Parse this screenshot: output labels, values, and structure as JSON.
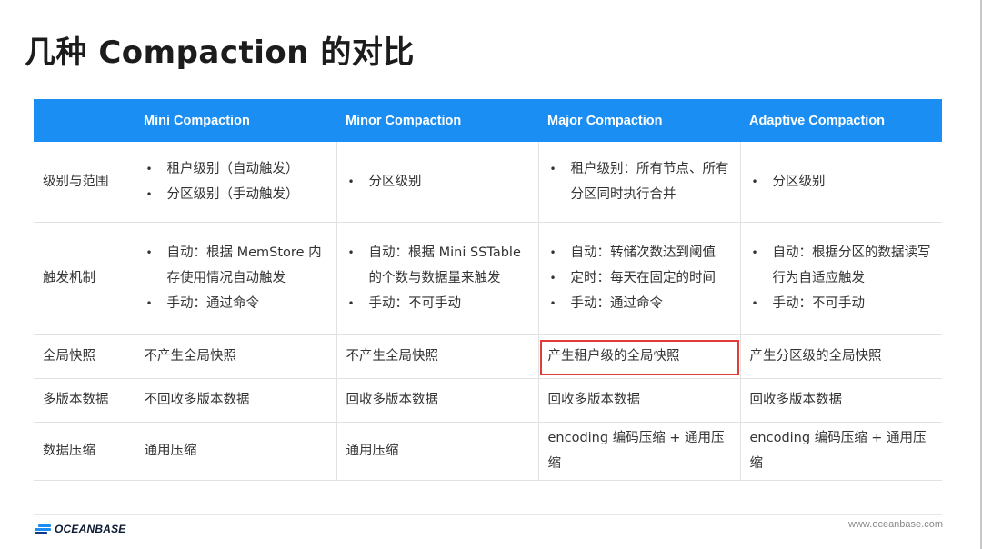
{
  "title": "几种 Compaction 的对比",
  "table": {
    "columns": [
      "",
      "Mini Compaction",
      "Minor Compaction",
      "Major Compaction",
      "Adaptive Compaction"
    ],
    "rows": [
      {
        "label": "级别与范围",
        "cells": [
          {
            "bullets": [
              "租户级别（自动触发）",
              "分区级别（手动触发）"
            ]
          },
          {
            "bullets": [
              "分区级别"
            ]
          },
          {
            "bullets": [
              "租户级别：所有节点、所有分区同时执行合并"
            ]
          },
          {
            "bullets": [
              "分区级别"
            ]
          }
        ]
      },
      {
        "label": "触发机制",
        "cells": [
          {
            "bullets": [
              "自动：根据 MemStore 内存使用情况自动触发",
              "手动：通过命令"
            ]
          },
          {
            "bullets": [
              "自动：根据 Mini SSTable 的个数与数据量来触发",
              "手动：不可手动"
            ]
          },
          {
            "bullets": [
              "自动：转储次数达到阈值",
              "定时：每天在固定的时间",
              "手动：通过命令"
            ]
          },
          {
            "bullets": [
              "自动：根据分区的数据读写行为自适应触发",
              "手动：不可手动"
            ]
          }
        ]
      },
      {
        "label": "全局快照",
        "cells": [
          {
            "text": "不产生全局快照"
          },
          {
            "text": "不产生全局快照"
          },
          {
            "text": "产生租户级的全局快照",
            "highlight": true
          },
          {
            "text": "产生分区级的全局快照"
          }
        ]
      },
      {
        "label": "多版本数据",
        "cells": [
          {
            "text": "不回收多版本数据"
          },
          {
            "text": "回收多版本数据"
          },
          {
            "text": "回收多版本数据"
          },
          {
            "text": "回收多版本数据"
          }
        ]
      },
      {
        "label": "数据压缩",
        "cells": [
          {
            "text": "通用压缩"
          },
          {
            "text": "通用压缩"
          },
          {
            "text": "encoding 编码压缩 + 通用压缩"
          },
          {
            "text": "encoding 编码压缩 + 通用压缩"
          }
        ]
      }
    ]
  },
  "footer": {
    "logo_text": "OCEANBASE",
    "url": "www.oceanbase.com"
  },
  "colors": {
    "header_bg": "#1a8ef2",
    "highlight_border": "#e03c3c",
    "logo_blue": "#1a8ef2",
    "logo_dark": "#0d3b8a"
  },
  "icons": {
    "logo": "oceanbase-logo-icon"
  }
}
